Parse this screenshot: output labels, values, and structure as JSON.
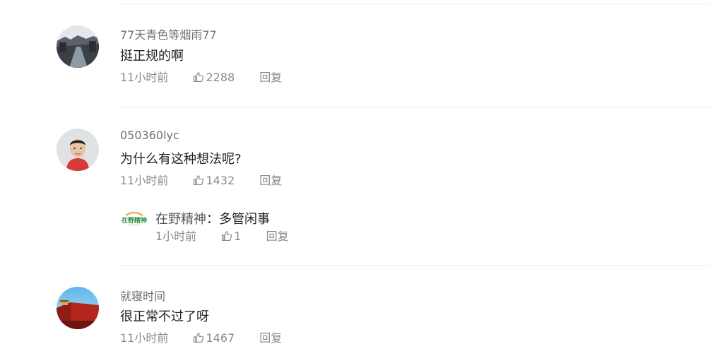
{
  "comments": [
    {
      "username": "77天青色等烟雨77",
      "text": "挺正规的啊",
      "time": "11小时前",
      "likes": "2288",
      "reply_label": "回复",
      "avatar_icon": "river-town-avatar-icon"
    },
    {
      "username": "050360lyc",
      "text": "为什么有这种想法呢?",
      "time": "11小时前",
      "likes": "1432",
      "reply_label": "回复",
      "avatar_icon": "portrait-avatar-icon",
      "reply": {
        "username": "在野精神",
        "separator": "：",
        "text": "多管闲事",
        "time": "1小时前",
        "likes": "1",
        "reply_label": "回复",
        "logo_text": "在野精神",
        "logo_icon": "zaiye-jingshen-logo-icon"
      }
    },
    {
      "username": "就寝时间",
      "text": "很正常不过了呀",
      "time": "11小时前",
      "likes": "1467",
      "reply_label": "回复",
      "avatar_icon": "red-wall-avatar-icon"
    }
  ],
  "colors": {
    "username": "#707070",
    "meta": "#8a8a8a",
    "text": "#222222",
    "divider": "#ececec",
    "logo_green": "#2e8b3d",
    "logo_orange": "#e8a33b"
  }
}
